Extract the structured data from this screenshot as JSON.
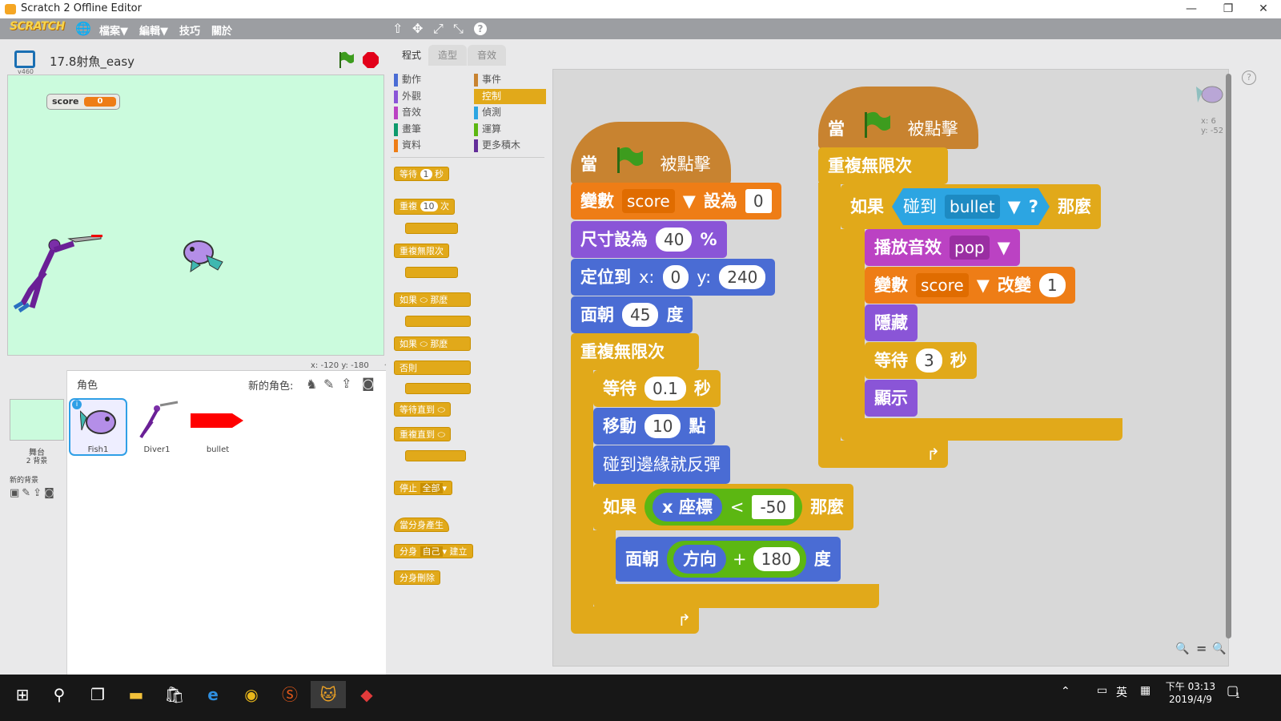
{
  "window": {
    "title": "Scratch 2 Offline Editor",
    "min": "—",
    "max": "❐",
    "close": "✕"
  },
  "menubar": {
    "logo": "SCRATCH",
    "menus": [
      "檔案▼",
      "編輯▼",
      "技巧",
      "關於"
    ],
    "tools": [
      "⇧",
      "✥",
      "⤢",
      "⤡",
      "?"
    ]
  },
  "project": {
    "title": "17.8射魚_easy",
    "version": "v460"
  },
  "stage": {
    "monitor": {
      "label": "score",
      "value": "0"
    },
    "coords": "x: -120  y: -180"
  },
  "sprites": {
    "header": "角色",
    "new_sprite": "新的角色:",
    "stage_label": "舞台",
    "stage_sub": "2 背景",
    "new_backdrop": "新的背景",
    "items": [
      "Fish1",
      "Diver1",
      "bullet"
    ]
  },
  "tabs": [
    "程式",
    "造型",
    "音效"
  ],
  "categories": [
    {
      "l": "動作",
      "c": "#4a6cd4"
    },
    {
      "l": "事件",
      "c": "#c88330"
    },
    {
      "l": "外觀",
      "c": "#8a55d7"
    },
    {
      "l": "控制",
      "c": "#e1a91a"
    },
    {
      "l": "音效",
      "c": "#bb42c3"
    },
    {
      "l": "偵測",
      "c": "#2ca5e2"
    },
    {
      "l": "畫筆",
      "c": "#0e9a6c"
    },
    {
      "l": "運算",
      "c": "#5cb712"
    },
    {
      "l": "資料",
      "c": "#ee7d16"
    },
    {
      "l": "更多積木",
      "c": "#632d99"
    }
  ],
  "palette": {
    "wait": "等待",
    "wait_n": "1",
    "sec": "秒",
    "repeat": "重複",
    "repeat_n": "10",
    "times": "次",
    "forever": "重複無限次",
    "if": "如果",
    "then": "那麼",
    "else": "否則",
    "wait_until": "等待直到",
    "repeat_until": "重複直到",
    "stop": "停止",
    "stop_all": "全部",
    "clone_start": "當分身產生",
    "clone": "分身",
    "myself": "自己",
    "create": "建立",
    "delete_clone": "分身刪除"
  },
  "script1": {
    "when": "當",
    "clicked": "被點擊",
    "set_var": "變數",
    "var": "score",
    "set_to": "設為",
    "set_val": "0",
    "size": "尺寸設為",
    "size_val": "40",
    "pct": "%",
    "goto": "定位到",
    "x": "x:",
    "x_val": "0",
    "y": "y:",
    "y_val": "240",
    "point": "面朝",
    "point_val": "45",
    "deg": "度",
    "forever": "重複無限次",
    "wait": "等待",
    "wait_val": "0.1",
    "sec": "秒",
    "move": "移動",
    "move_val": "10",
    "steps": "點",
    "bounce": "碰到邊緣就反彈",
    "if": "如果",
    "xpos": "x 座標",
    "lt": "<",
    "lt_val": "-50",
    "then": "那麼",
    "point2": "面朝",
    "dir": "方向",
    "plus": "+",
    "plus_val": "180",
    "deg2": "度"
  },
  "script2": {
    "when": "當",
    "clicked": "被點擊",
    "forever": "重複無限次",
    "if": "如果",
    "touch": "碰到",
    "touch_obj": "bullet",
    "q": "?",
    "then": "那麼",
    "play": "播放音效",
    "sound": "pop",
    "change": "變數",
    "var": "score",
    "change_by": "改變",
    "change_val": "1",
    "hide": "隱藏",
    "wait": "等待",
    "wait_val": "3",
    "sec": "秒",
    "show": "顯示"
  },
  "sprite_info": {
    "x": "x: 6",
    "y": "y: -52"
  },
  "zoom": {
    "out": "🔍",
    "reset": "=",
    "in": "🔍"
  },
  "taskbar": {
    "time": "下午 03:13",
    "date": "2019/4/9",
    "lang": "英",
    "notif": "1"
  }
}
